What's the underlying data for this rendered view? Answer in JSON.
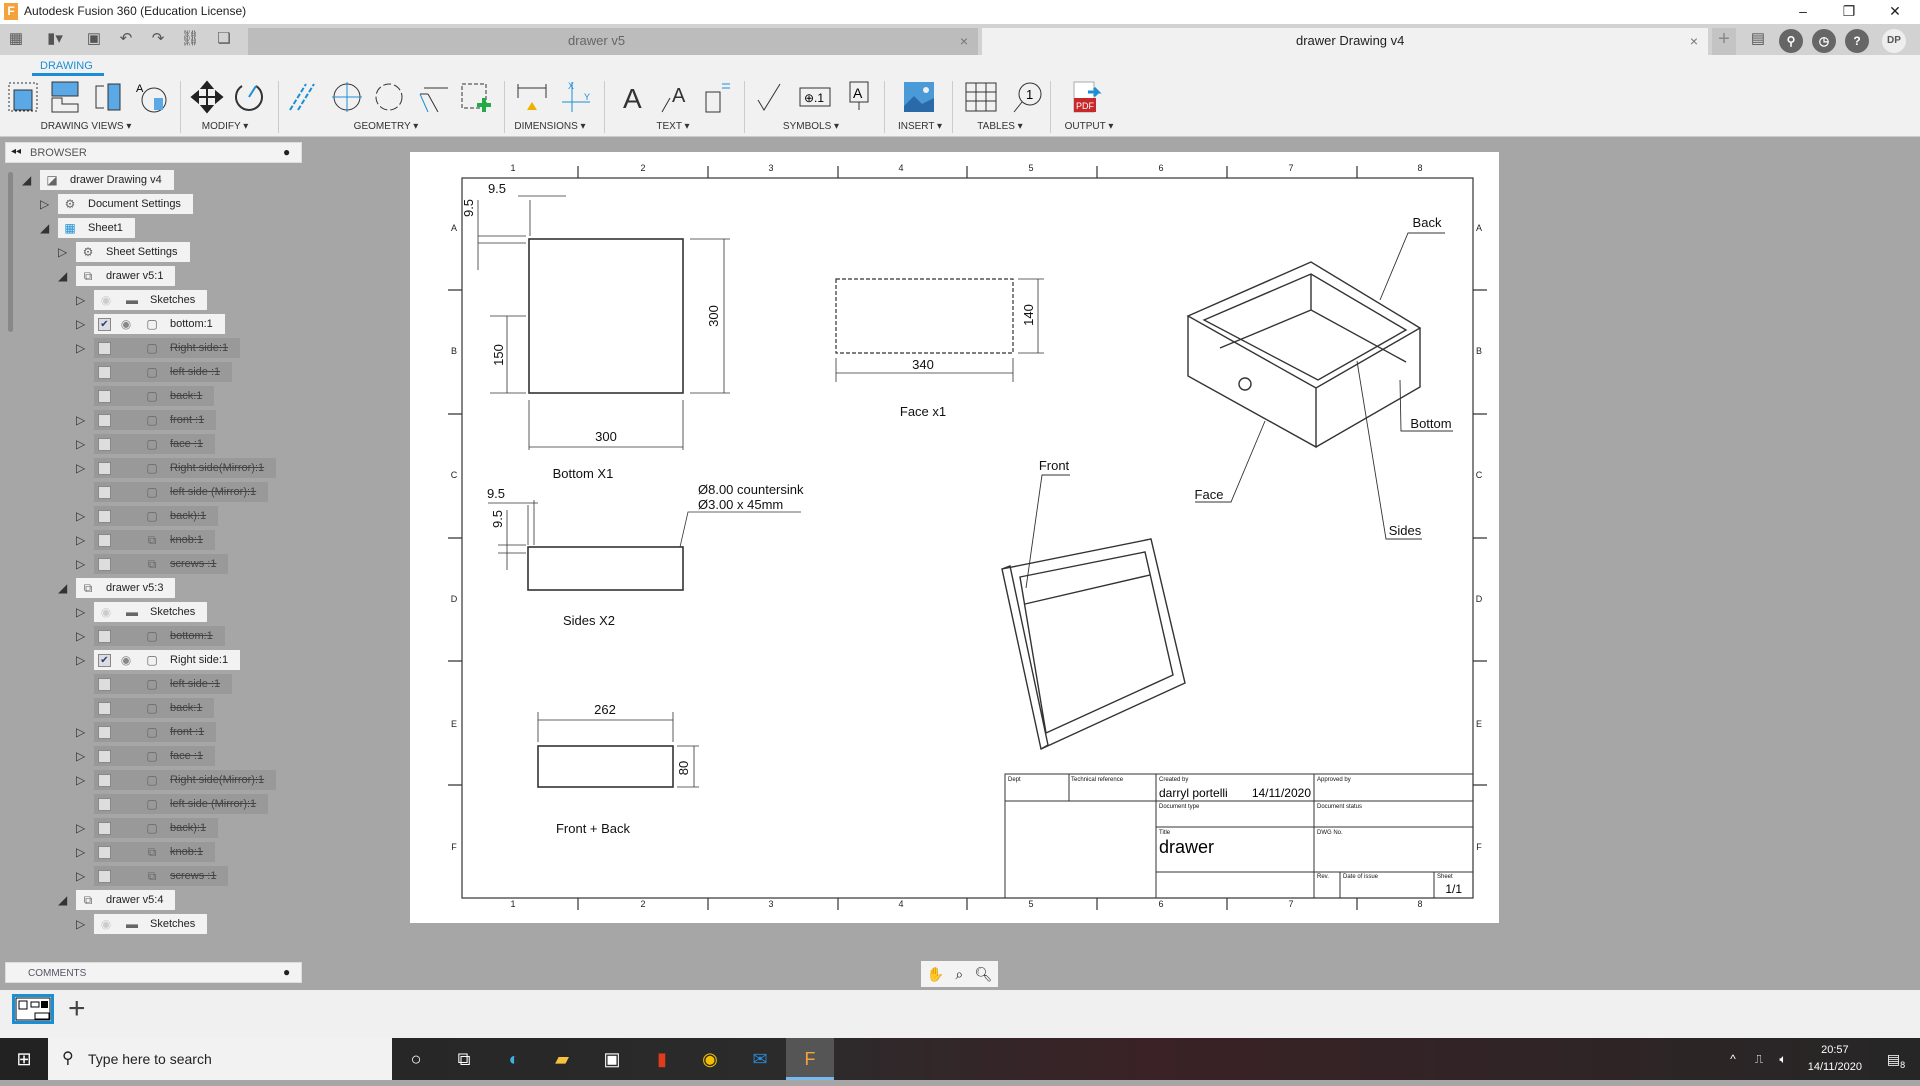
{
  "window": {
    "title": "Autodesk Fusion 360 (Education License)"
  },
  "tabs": [
    {
      "label": "drawer v5"
    },
    {
      "label": "drawer Drawing v4"
    }
  ],
  "user_initials": "DP",
  "workspace_tab": "DRAWING",
  "toolbar_groups": [
    "DRAWING VIEWS ▾",
    "MODIFY ▾",
    "GEOMETRY ▾",
    "DIMENSIONS ▾",
    "TEXT ▾",
    "SYMBOLS ▾",
    "INSERT ▾",
    "TABLES ▾",
    "OUTPUT ▾"
  ],
  "browser": {
    "title": "BROWSER",
    "items": [
      {
        "level": 0,
        "exp": "open",
        "icon": "drawing",
        "label": "drawer Drawing v4"
      },
      {
        "level": 1,
        "exp": "closed",
        "icon": "gear",
        "label": "Document Settings"
      },
      {
        "level": 1,
        "exp": "open",
        "icon": "sheet",
        "label": "Sheet1"
      },
      {
        "level": 2,
        "exp": "closed",
        "icon": "gear",
        "label": "Sheet Settings"
      },
      {
        "level": 2,
        "exp": "open",
        "icon": "component",
        "label": "drawer v5:1"
      },
      {
        "level": 3,
        "exp": "closed",
        "icon": "folder",
        "eye": "hidden",
        "label": "Sketches"
      },
      {
        "level": 3,
        "exp": "closed",
        "check": true,
        "eye": "visible",
        "icon": "body",
        "label": "bottom:1"
      },
      {
        "level": 3,
        "exp": "closed",
        "check": false,
        "icon": "body",
        "label": "Right side:1",
        "suppressed": true
      },
      {
        "level": 3,
        "exp": "none",
        "check": false,
        "icon": "body",
        "label": "left side :1",
        "suppressed": true
      },
      {
        "level": 3,
        "exp": "none",
        "check": false,
        "icon": "body",
        "label": "back:1",
        "suppressed": true
      },
      {
        "level": 3,
        "exp": "closed",
        "check": false,
        "icon": "body",
        "label": "front :1",
        "suppressed": true
      },
      {
        "level": 3,
        "exp": "closed",
        "check": false,
        "icon": "body",
        "label": "face :1",
        "suppressed": true
      },
      {
        "level": 3,
        "exp": "closed",
        "check": false,
        "icon": "body",
        "label": "Right side(Mirror):1",
        "suppressed": true
      },
      {
        "level": 3,
        "exp": "none",
        "check": false,
        "icon": "body",
        "label": "left side (Mirror):1",
        "suppressed": true
      },
      {
        "level": 3,
        "exp": "closed",
        "check": false,
        "icon": "body",
        "label": "back):1",
        "suppressed": true
      },
      {
        "level": 3,
        "exp": "closed",
        "check": false,
        "icon": "component",
        "label": "knob:1",
        "suppressed": true
      },
      {
        "level": 3,
        "exp": "closed",
        "check": false,
        "icon": "component",
        "label": "screws :1",
        "suppressed": true
      },
      {
        "level": 2,
        "exp": "open",
        "icon": "component",
        "label": "drawer v5:3"
      },
      {
        "level": 3,
        "exp": "closed",
        "icon": "folder",
        "eye": "hidden",
        "label": "Sketches"
      },
      {
        "level": 3,
        "exp": "closed",
        "check": false,
        "icon": "body",
        "label": "bottom:1",
        "suppressed": true
      },
      {
        "level": 3,
        "exp": "closed",
        "check": true,
        "eye": "visible",
        "icon": "body",
        "label": "Right side:1"
      },
      {
        "level": 3,
        "exp": "none",
        "check": false,
        "icon": "body",
        "label": "left side :1",
        "suppressed": true
      },
      {
        "level": 3,
        "exp": "none",
        "check": false,
        "icon": "body",
        "label": "back:1",
        "suppressed": true
      },
      {
        "level": 3,
        "exp": "closed",
        "check": false,
        "icon": "body",
        "label": "front :1",
        "suppressed": true
      },
      {
        "level": 3,
        "exp": "closed",
        "check": false,
        "icon": "body",
        "label": "face :1",
        "suppressed": true
      },
      {
        "level": 3,
        "exp": "closed",
        "check": false,
        "icon": "body",
        "label": "Right side(Mirror):1",
        "suppressed": true
      },
      {
        "level": 3,
        "exp": "none",
        "check": false,
        "icon": "body",
        "label": "left side (Mirror):1",
        "suppressed": true
      },
      {
        "level": 3,
        "exp": "closed",
        "check": false,
        "icon": "body",
        "label": "back):1",
        "suppressed": true
      },
      {
        "level": 3,
        "exp": "closed",
        "check": false,
        "icon": "component",
        "label": "knob:1",
        "suppressed": true
      },
      {
        "level": 3,
        "exp": "closed",
        "check": false,
        "icon": "component",
        "label": "screws :1",
        "suppressed": true
      },
      {
        "level": 2,
        "exp": "open",
        "icon": "component",
        "label": "drawer v5:4"
      },
      {
        "level": 3,
        "exp": "closed",
        "icon": "folder",
        "eye": "hidden",
        "label": "Sketches"
      }
    ]
  },
  "comments": {
    "title": "COMMENTS"
  },
  "drawing": {
    "zone_columns": [
      "1",
      "2",
      "3",
      "4",
      "5",
      "6",
      "7",
      "8"
    ],
    "zone_rows": [
      "A",
      "B",
      "C",
      "D",
      "E",
      "F"
    ],
    "dims": {
      "bottom_w": "300",
      "bottom_h": "300",
      "bottom_hole": "150",
      "bottom_off_x": "9.5",
      "bottom_off_y": "9.5",
      "face_w": "340",
      "face_h": "140",
      "sides_off_x": "9.5",
      "sides_off_y": "9.5",
      "fb_w": "262",
      "fb_h": "80"
    },
    "notes": {
      "hole1": "Ø8.00 countersink",
      "hole2": "Ø3.00 x 45mm"
    },
    "view_labels": {
      "bottom": "Bottom X1",
      "face": "Face x1",
      "sides": "Sides X2",
      "front_back": "Front + Back"
    },
    "callouts": {
      "back": "Back",
      "bottom": "Bottom",
      "face": "Face",
      "sides": "Sides",
      "front": "Front"
    },
    "title_block": {
      "dept": "Dept",
      "tech_ref": "Technical reference",
      "created_by_label": "Created by",
      "created_by": "darryl portelli",
      "date": "14/11/2020",
      "approved_by": "Approved by",
      "doc_type": "Document type",
      "doc_status": "Document status",
      "title_label": "Title",
      "title": "drawer",
      "dwg_no": "DWG No.",
      "rev": "Rev.",
      "date_of_issue": "Date of issue",
      "sheet_label": "Sheet",
      "sheet": "1/1"
    }
  },
  "taskbar": {
    "search_placeholder": "Type here to search",
    "time": "20:57",
    "date": "14/11/2020",
    "notifications": "8"
  }
}
